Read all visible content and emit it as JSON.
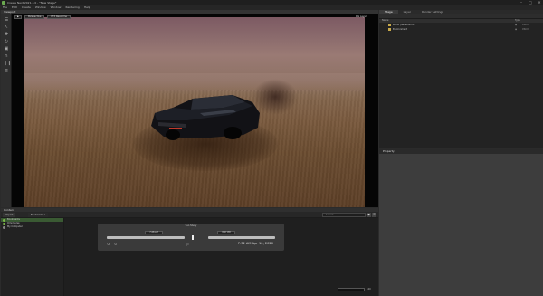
{
  "window": {
    "title": "Create Next 2021.3.0 - *New Stage*",
    "controls": [
      "–",
      "□",
      "✕"
    ]
  },
  "menu": [
    "File",
    "Edit",
    "Create",
    "Window",
    "Window",
    "Rendering",
    "Help"
  ],
  "viewport": {
    "tab_label": "Viewport",
    "toolbar": [
      "▶",
      "Perspective",
      "RTX Real-time"
    ],
    "right_label": "Rtx Layer",
    "tools": [
      "☰",
      "↖",
      "✚",
      "↻",
      "▣",
      "∩",
      "❙❙",
      "≡"
    ]
  },
  "stage": {
    "tabs": [
      "Stage",
      "Layer",
      "Render Settings"
    ],
    "header": {
      "name": "Name",
      "type": "Type"
    },
    "rows": [
      {
        "name": "World (defaultPrim)",
        "vis": "◉",
        "type": "Xform"
      },
      {
        "name": "Environment",
        "vis": "◉",
        "type": "Xform"
      }
    ]
  },
  "property": {
    "tab_label": "Property"
  },
  "content": {
    "tab_label": "Content",
    "toolbar": {
      "import_label": "Import",
      "path": "Bookmarks ▾",
      "search_placeholder": "Search",
      "filter_icon": "▼",
      "menu_icon": "☰"
    },
    "tree": [
      {
        "label": "Bookmarks",
        "selected": true
      },
      {
        "label": "Omniverse",
        "selected": false
      },
      {
        "label": "My Computer",
        "selected": false
      }
    ]
  },
  "timeline": {
    "title": "Sun Study",
    "start_time": "7:28 AM",
    "end_time": "8:07 PM",
    "current": "7:32 AM  Apr 10, 2020",
    "prev": "↺",
    "loop": "↻",
    "play": "▷"
  },
  "status": {
    "right_value": "100"
  }
}
